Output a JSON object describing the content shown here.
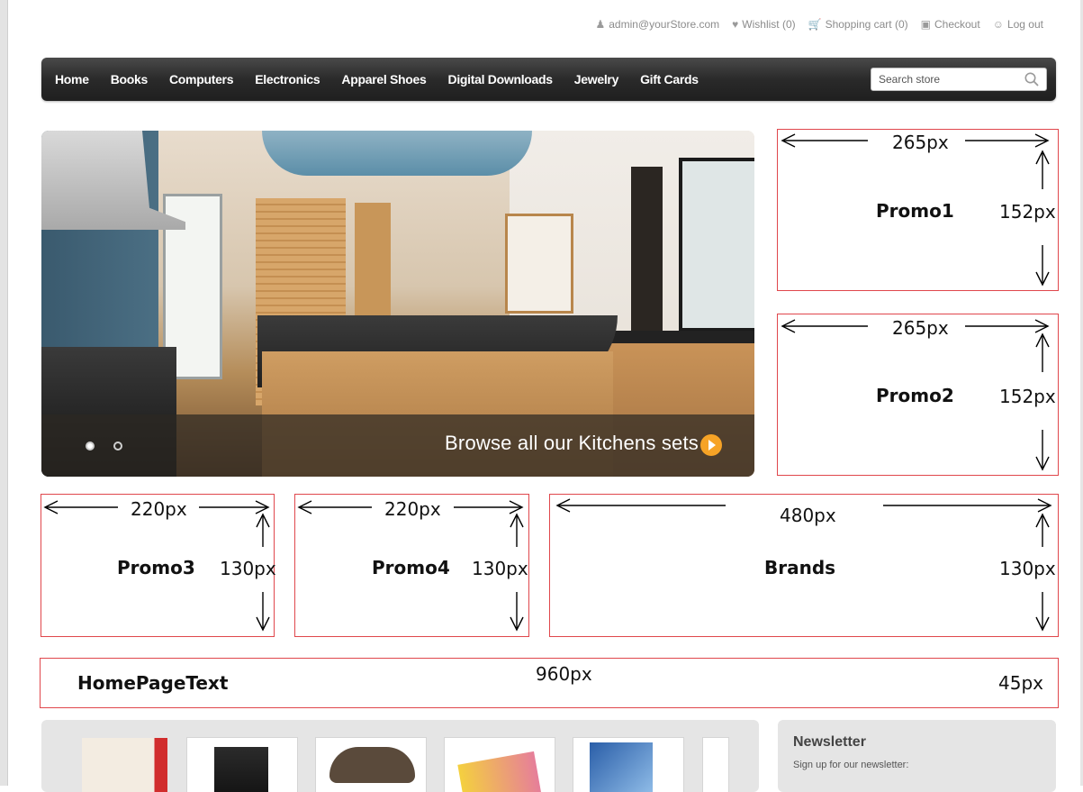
{
  "header": {
    "links": [
      {
        "icon": "user-icon",
        "label": "admin@yourStore.com"
      },
      {
        "icon": "heart-icon",
        "label": "Wishlist (0)"
      },
      {
        "icon": "cart-icon",
        "label": "Shopping cart (0)"
      },
      {
        "icon": "checkout-icon",
        "label": "Checkout"
      },
      {
        "icon": "logout-icon",
        "label": "Log out"
      }
    ]
  },
  "nav": {
    "items": [
      "Home",
      "Books",
      "Computers",
      "Electronics",
      "Apparel Shoes",
      "Digital Downloads",
      "Jewelry",
      "Gift Cards"
    ],
    "search_placeholder": "Search store"
  },
  "slider": {
    "caption": "Browse all our Kitchens sets",
    "dots": 2,
    "active_dot": 1
  },
  "promos": {
    "promo1": {
      "label": "Promo1",
      "width_label": "265px",
      "height_label": "152px"
    },
    "promo2": {
      "label": "Promo2",
      "width_label": "265px",
      "height_label": "152px"
    },
    "promo3": {
      "label": "Promo3",
      "width_label": "220px",
      "height_label": "130px"
    },
    "promo4": {
      "label": "Promo4",
      "width_label": "220px",
      "height_label": "130px"
    },
    "brands": {
      "label": "Brands",
      "width_label": "480px",
      "height_label": "130px"
    },
    "homepage_text": {
      "label": "HomePageText",
      "width_label": "960px",
      "height_label": "45px"
    }
  },
  "newsletter": {
    "title": "Newsletter",
    "subtitle": "Sign up for our newsletter:"
  },
  "colors": {
    "box_border": "#e0474c",
    "nav_bg": "#2a2a2a",
    "accent": "#f6a326"
  }
}
